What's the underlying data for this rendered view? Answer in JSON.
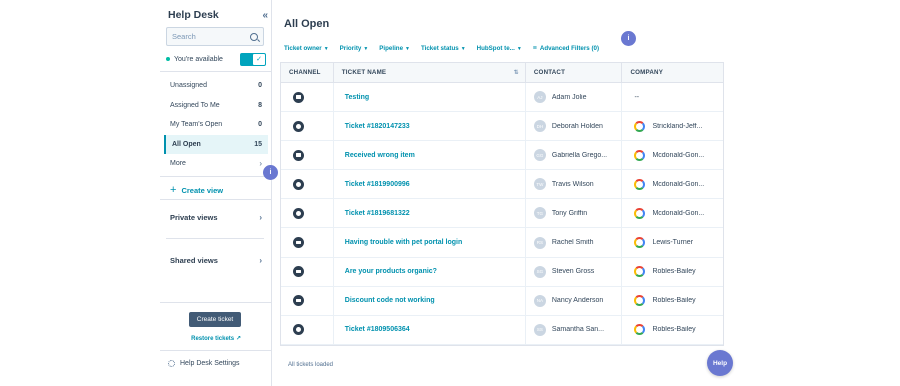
{
  "sidebar": {
    "title": "Help Desk",
    "search_placeholder": "Search",
    "availability_label": "You're available",
    "views": [
      {
        "label": "Unassigned",
        "count": "0"
      },
      {
        "label": "Assigned To Me",
        "count": "8"
      },
      {
        "label": "My Team's Open",
        "count": "0"
      },
      {
        "label": "All Open",
        "count": "15",
        "active": true
      },
      {
        "label": "More",
        "count": ""
      }
    ],
    "create_view_label": "Create view",
    "private_views_label": "Private views",
    "shared_views_label": "Shared views",
    "create_ticket_label": "Create ticket",
    "restore_tickets_label": "Restore tickets",
    "settings_label": "Help Desk Settings"
  },
  "main": {
    "title": "All Open",
    "filters": [
      "Ticket owner",
      "Priority",
      "Pipeline",
      "Ticket status",
      "HubSpot te..."
    ],
    "advanced_filters_label": "Advanced Filters (0)",
    "columns": [
      "CHANNEL",
      "TICKET NAME",
      "CONTACT",
      "COMPANY"
    ],
    "rows": [
      {
        "channel": "email",
        "ticket": "Testing",
        "initials": "AJ",
        "contact": "Adam Jolie",
        "company": "--"
      },
      {
        "channel": "chat",
        "ticket": "Ticket #1820147233",
        "initials": "DH",
        "contact": "Deborah Holden",
        "company": "Strickland-Jeff..."
      },
      {
        "channel": "email",
        "ticket": "Received wrong item",
        "initials": "GG",
        "contact": "Gabriella Grego...",
        "company": "Mcdonald-Gon..."
      },
      {
        "channel": "chat",
        "ticket": "Ticket #1819900996",
        "initials": "TW",
        "contact": "Travis Wilson",
        "company": "Mcdonald-Gon..."
      },
      {
        "channel": "chat",
        "ticket": "Ticket #1819681322",
        "initials": "TG",
        "contact": "Tony Griffin",
        "company": "Mcdonald-Gon..."
      },
      {
        "channel": "email",
        "ticket": "Having trouble with pet portal login",
        "initials": "RS",
        "contact": "Rachel Smith",
        "company": "Lewis-Turner"
      },
      {
        "channel": "email",
        "ticket": "Are your products organic?",
        "initials": "SG",
        "contact": "Steven Gross",
        "company": "Robles-Bailey"
      },
      {
        "channel": "email",
        "ticket": "Discount code not working",
        "initials": "NA",
        "contact": "Nancy Anderson",
        "company": "Robles-Bailey"
      },
      {
        "channel": "chat",
        "ticket": "Ticket #1809506364",
        "initials": "SS",
        "contact": "Samantha San...",
        "company": "Robles-Bailey"
      }
    ],
    "footer_label": "All tickets loaded",
    "help_label": "Help",
    "info_label": "i"
  }
}
